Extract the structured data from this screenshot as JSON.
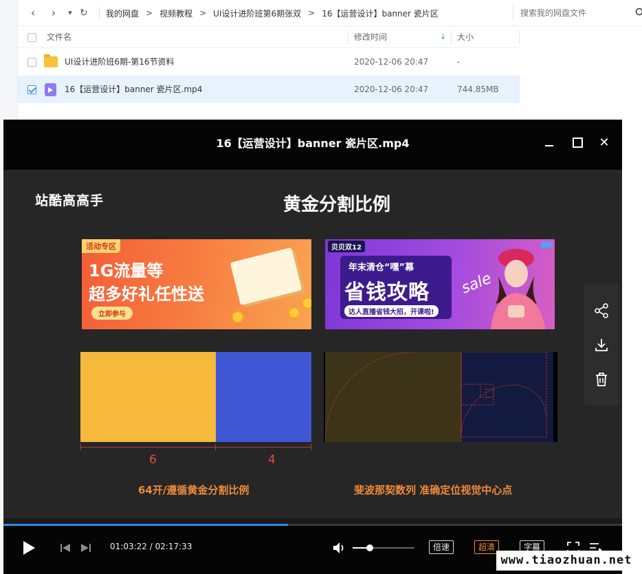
{
  "nav": {
    "back_glyph": "‹",
    "forward_glyph": "›",
    "dropdown_glyph": "▾",
    "refresh_glyph": "↻"
  },
  "breadcrumb": [
    "我的网盘",
    "视频教程",
    "UI设计进阶班第6期张双",
    "16【运营设计】banner 瓷片区"
  ],
  "breadcrumb_sep": ">",
  "search": {
    "placeholder": "搜索我的网盘文件"
  },
  "list": {
    "columns": {
      "name": "文件名",
      "modified": "修改时间",
      "size": "大小"
    },
    "sort_glyph": "↓",
    "rows": [
      {
        "name": "UI设计进阶班6期-第16节资料",
        "modified": "2020-12-06 20:47",
        "size": "-",
        "type": "folder",
        "checked": false
      },
      {
        "name": "16【运营设计】banner 瓷片区.mp4",
        "modified": "2020-12-06 20:47",
        "size": "744.85MB",
        "type": "video",
        "checked": true
      }
    ]
  },
  "player": {
    "title": "16【运营设计】banner 瓷片区.mp4",
    "close_glyph": "✕",
    "slide": {
      "logo": "站酷高高手",
      "title": "黄金分割比例",
      "banner_a": {
        "tag": "活动专区",
        "line1": "1G流量等",
        "line2": "超多好礼任性送",
        "cta": "立即参与"
      },
      "banner_b": {
        "tag": "贝贝双12",
        "sub": "年末清仓“嘿”幕",
        "headline": "省钱攻略",
        "cta": "达人直播省钱大招，开课啦!",
        "sale": "sale"
      },
      "ratio_left": "6",
      "ratio_right": "4",
      "caption_left": "64开/遵循黄金分割比例",
      "caption_right": "斐波那契数列  准确定位视觉中心点"
    },
    "progress": 0.46,
    "volume": 0.28,
    "time_current": "01:03:22",
    "time_separator": " / ",
    "time_total": "02:17:33",
    "buttons": {
      "speed": "倍速",
      "quality": "超清",
      "subtitle": "字幕"
    },
    "colors": {
      "accent": "#2d8cf0",
      "highlight": "#f08b3a",
      "gold": "#f6b93b",
      "blue": "#3f57d4"
    }
  },
  "site_watermark": "www.tiaozhuan.net"
}
